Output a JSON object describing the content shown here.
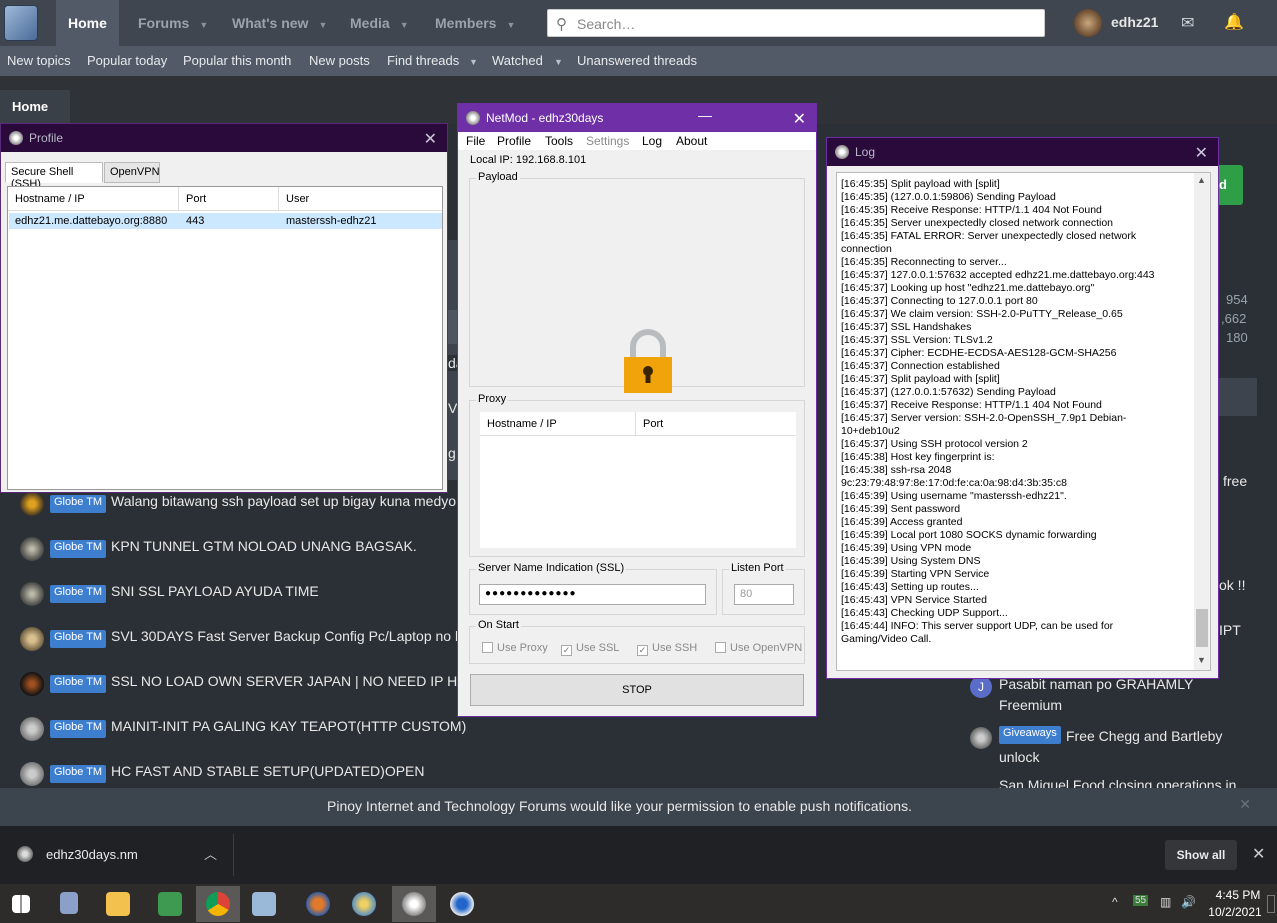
{
  "forum": {
    "nav": {
      "home": "Home",
      "forums": "Forums",
      "whats_new": "What's new",
      "media": "Media",
      "members": "Members"
    },
    "search_placeholder": "Search…",
    "user": "edhz21",
    "subnav": [
      "New topics",
      "Popular today",
      "Popular this month",
      "New posts",
      "Find threads",
      "Watched",
      "Unanswered threads"
    ],
    "breadcrumb": "Home",
    "threads": [
      {
        "badge": "Globe TM",
        "title": "Walang bitawang ssh payload set up bigay kuna medyo"
      },
      {
        "badge": "Globe TM",
        "title": "KPN TUNNEL GTM NOLOAD UNANG BAGSAK."
      },
      {
        "badge": "Globe TM",
        "title": "SNI SSL PAYLOAD AYUDA TIME"
      },
      {
        "badge": "Globe TM",
        "title": "SVL 30DAYS Fast Server Backup Config Pc/Laptop no br"
      },
      {
        "badge": "Globe TM",
        "title": "SSL NO LOAD OWN SERVER JAPAN | NO NEED IP HUNT"
      },
      {
        "badge": "Globe TM",
        "title": "MAINIT-INIT PA GALING KAY TEAPOT(HTTP CUSTOM)"
      },
      {
        "badge": "Globe TM",
        "title": "HC FAST AND STABLE SETUP(UPDATED)OPEN"
      }
    ],
    "partial_row_text": [
      "da",
      "VE",
      "g h"
    ],
    "sidebar": {
      "partial_button": "d",
      "counts": [
        "954",
        ",662",
        "180"
      ],
      "right_snippets": [
        "free",
        "ok !!",
        "IPT"
      ],
      "item1": "Pasabit naman po GRAHAMLY Freemium",
      "item1_avatar": "J",
      "item2_badge": "Giveaways",
      "item2": "Free Chegg and Bartleby unlock",
      "item3": "San Miguel Food closing operations in"
    },
    "push_notice": "Pinoy Internet and Technology Forums would like your permission to enable push notifications."
  },
  "profile_window": {
    "title": "Profile",
    "tabs": [
      "Secure Shell (SSH)",
      "OpenVPN"
    ],
    "columns": [
      "Hostname / IP",
      "Port",
      "User"
    ],
    "rows": [
      {
        "host": "edhz21.me.dattebayo.org:8880",
        "port": "443",
        "user": "masterssh-edhz21"
      }
    ]
  },
  "netmod": {
    "title": "NetMod - edhz30days",
    "menu": [
      "File",
      "Profile",
      "Tools",
      "Settings",
      "Log",
      "About"
    ],
    "local_ip": "Local IP: 192.168.8.101",
    "payload_label": "Payload",
    "proxy_label": "Proxy",
    "proxy_columns": [
      "Hostname / IP",
      "Port"
    ],
    "sni_label": "Server Name Indication (SSL)",
    "sni_value": "●●●●●●●●●●●●●",
    "listen_label": "Listen Port",
    "listen_placeholder": "80",
    "on_start_label": "On Start",
    "options": [
      {
        "label": "Use Proxy",
        "checked": false
      },
      {
        "label": "Use SSL",
        "checked": true
      },
      {
        "label": "Use SSH",
        "checked": true
      },
      {
        "label": "Use OpenVPN",
        "checked": false
      }
    ],
    "stop_label": "STOP"
  },
  "log_window": {
    "title": "Log",
    "text": "[16:45:35] Split payload with [split]\n[16:45:35] (127.0.0.1:59806) Sending Payload\n[16:45:35] Receive Response: HTTP/1.1 404 Not Found\n[16:45:35] Server unexpectedly closed network connection\n[16:45:35] FATAL ERROR: Server unexpectedly closed network\nconnection\n[16:45:35] Reconnecting to server...\n[16:45:37] 127.0.0.1:57632 accepted edhz21.me.dattebayo.org:443\n[16:45:37] Looking up host \"edhz21.me.dattebayo.org\"\n[16:45:37] Connecting to 127.0.0.1 port 80\n[16:45:37] We claim version: SSH-2.0-PuTTY_Release_0.65\n[16:45:37] SSL Handshakes\n[16:45:37] SSL Version: TLSv1.2\n[16:45:37] Cipher: ECDHE-ECDSA-AES128-GCM-SHA256\n[16:45:37] Connection established\n[16:45:37] Split payload with [split]\n[16:45:37] (127.0.0.1:57632) Sending Payload\n[16:45:37] Receive Response: HTTP/1.1 404 Not Found\n[16:45:37] Server version: SSH-2.0-OpenSSH_7.9p1 Debian-\n10+deb10u2\n[16:45:37] Using SSH protocol version 2\n[16:45:38] Host key fingerprint is:\n[16:45:38] ssh-rsa 2048\n9c:23:79:48:97:8e:17:0d:fe:ca:0a:98:d4:3b:35:c8\n[16:45:39] Using username \"masterssh-edhz21\".\n[16:45:39] Sent password\n[16:45:39] Access granted\n[16:45:39] Local port 1080 SOCKS dynamic forwarding\n[16:45:39] Using VPN mode\n[16:45:39] Using System DNS\n[16:45:39] Starting VPN Service\n[16:45:43] Setting up routes...\n[16:45:43] VPN Service Started\n[16:45:43] Checking UDP Support...\n[16:45:44] INFO: This server support UDP, can be used for\nGaming/Video Call."
  },
  "download_bar": {
    "file": "edhz30days.nm",
    "show_all": "Show all"
  },
  "taskbar": {
    "time": "4:45 PM",
    "date": "10/2/2021",
    "battery": "55"
  },
  "colors": {
    "accent": "#6e2fa7",
    "badge": "#3d7ecf",
    "lock": "#f0a30a",
    "green_button": "#2e9e47"
  }
}
